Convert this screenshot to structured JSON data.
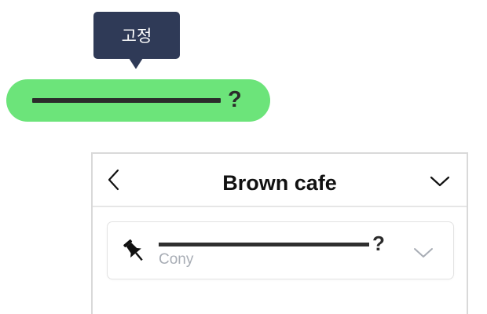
{
  "tooltip": {
    "label": "고정"
  },
  "bubble": {
    "text_placeholder": "",
    "suffix": "?",
    "color": "#6ce47a"
  },
  "chat": {
    "title": "Brown cafe",
    "back_icon": "chevron-left-icon",
    "menu_icon": "chevron-down-icon",
    "pinned": {
      "icon": "pin-icon",
      "suffix": "?",
      "author": "Cony",
      "expand_icon": "chevron-down-icon"
    }
  },
  "colors": {
    "tooltip_bg": "#2f3a57",
    "bubble_green": "#6ce47a",
    "text_dark": "#111111",
    "author_gray": "#a8adb5"
  }
}
